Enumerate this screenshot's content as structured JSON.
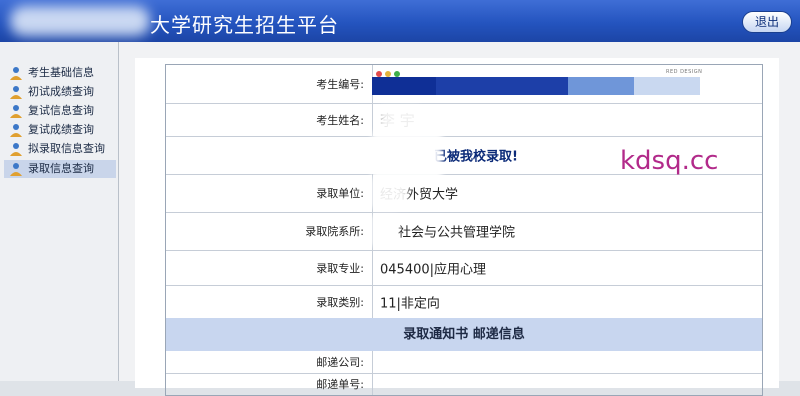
{
  "header": {
    "title": "大学研究生招生平台",
    "logout_label": "退出"
  },
  "sidebar": {
    "items": [
      {
        "label": "考生基础信息"
      },
      {
        "label": "初试成绩查询"
      },
      {
        "label": "复试信息查询"
      },
      {
        "label": "复试成绩查询"
      },
      {
        "label": "拟录取信息查询"
      },
      {
        "label": "录取信息查询"
      }
    ],
    "active_index": 5
  },
  "record": {
    "exam_no_label": "考生编号:",
    "name_label": "考生姓名:",
    "name_value": "李 宇",
    "notice": "已被我校录取!",
    "unit_label": "录取单位:",
    "unit_value": "经济外贸大学",
    "dept_label": "录取院系所:",
    "dept_value": "社会与公共管理学院",
    "major_label": "录取专业:",
    "major_value": "045400|应用心理",
    "type_label": "录取类别:",
    "type_value": "11|非定向",
    "mail_section_title": "录取通知书 邮递信息",
    "courier_label": "邮递公司:",
    "tracking_label": "邮递单号:"
  },
  "watermark": "kdsq.cc",
  "image_brand": "RED DESIGN",
  "colors": {
    "header_blue": "#2454bf",
    "banner_blue": "#c8d6ef",
    "watermark": "#b22a8a"
  },
  "icons": {
    "sidebar_item": "person-icon",
    "window_dots": [
      "red-dot",
      "yellow-dot",
      "green-dot"
    ]
  }
}
